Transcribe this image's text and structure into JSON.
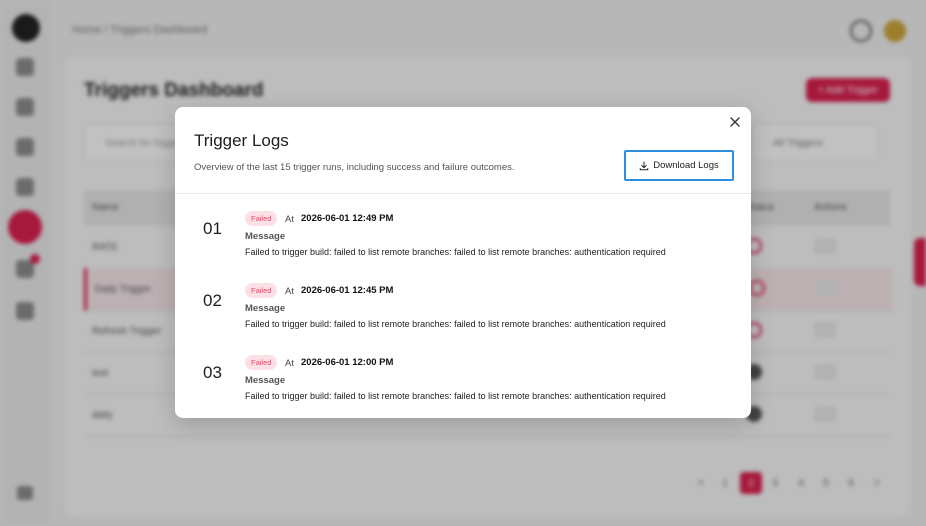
{
  "background": {
    "breadcrumb": "Home / Triggers Dashboard",
    "page_title": "Triggers Dashboard",
    "add_button": "+ Add Trigger",
    "search_placeholder": "Search for triggers...",
    "filter_value": "All Triggers",
    "table_headers": [
      "Name",
      "Status",
      "Actions"
    ],
    "rows": [
      {
        "name": "RATE"
      },
      {
        "name": "Daily Trigger"
      },
      {
        "name": "Refresh Trigger"
      },
      {
        "name": "test"
      },
      {
        "name": "daily"
      }
    ],
    "pages": [
      "<",
      "1",
      "2",
      "3",
      "4",
      "5",
      "6",
      ">"
    ],
    "current_page": "2"
  },
  "modal": {
    "title": "Trigger Logs",
    "description": "Overview of the last 15 trigger runs, including success and failure outcomes.",
    "download_label": "Download Logs",
    "at_label": "At",
    "message_label": "Message",
    "logs": [
      {
        "index": "01",
        "status": "Failed",
        "time": "2026-06-01 12:49 PM",
        "message": "Failed to trigger build: failed to list remote branches: failed to list remote branches: authentication required"
      },
      {
        "index": "02",
        "status": "Failed",
        "time": "2026-06-01 12:45 PM",
        "message": "Failed to trigger build: failed to list remote branches: failed to list remote branches: authentication required"
      },
      {
        "index": "03",
        "status": "Failed",
        "time": "2026-06-01 12:00 PM",
        "message": "Failed to trigger build: failed to list remote branches: failed to list remote branches: authentication required"
      }
    ]
  },
  "colors": {
    "accent": "#d6204e",
    "failed_bg": "#fbe1e6",
    "failed_text": "#e04e6b",
    "focus_outline": "#2d8fe0"
  },
  "icons": {
    "close": "close-icon",
    "download": "download-icon"
  }
}
